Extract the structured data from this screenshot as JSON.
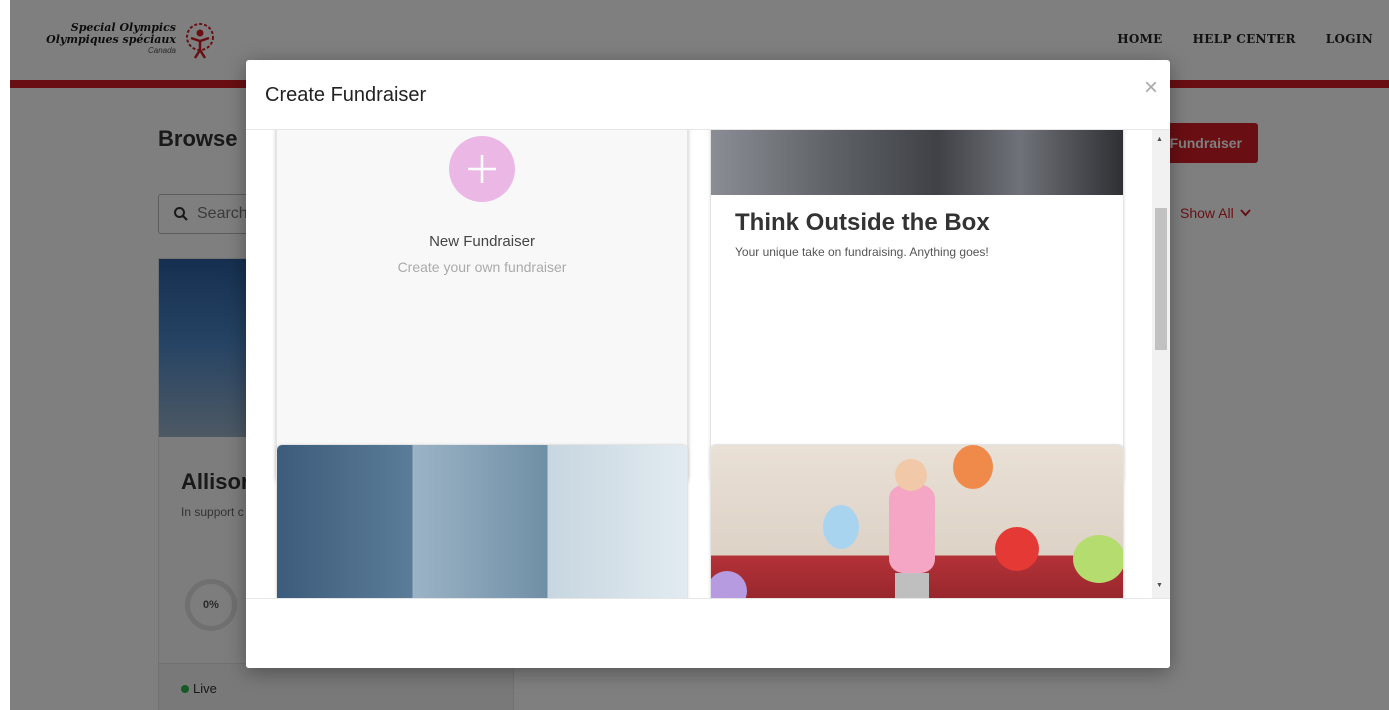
{
  "header": {
    "logo": {
      "line1": "Special Olympics",
      "line2": "Olympiques spéciaux",
      "line3": "Canada"
    },
    "nav": [
      {
        "label": "HOME"
      },
      {
        "label": "HELP CENTER"
      },
      {
        "label": "LOGIN"
      }
    ],
    "accent_color": "#d21f26"
  },
  "page": {
    "title": "Browse",
    "search_placeholder": "Search",
    "create_button": "Fundraiser",
    "show_all": "Show All",
    "card": {
      "name": "Allisor",
      "subtitle": "In support c",
      "progress": "0%",
      "status": "Live"
    }
  },
  "modal": {
    "title": "Create Fundraiser",
    "close_icon": "×",
    "templates": [
      {
        "title": "New Fundraiser",
        "subtitle": "Create your own fundraiser"
      },
      {
        "title": "Think Outside the Box",
        "subtitle": "Your unique take on fundraising. Anything goes!"
      }
    ]
  }
}
